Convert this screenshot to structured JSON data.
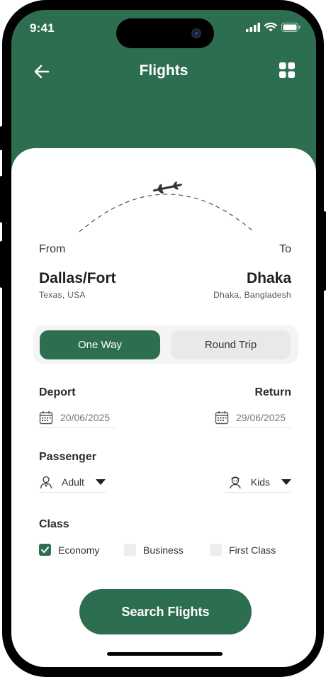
{
  "status": {
    "time": "9:41"
  },
  "header": {
    "title": "Flights"
  },
  "route": {
    "from_label": "From",
    "to_label": "To",
    "from_city": "Dallas/Fort",
    "from_region": "Texas, USA",
    "to_city": "Dhaka",
    "to_region": "Dhaka, Bangladesh"
  },
  "trip_type": {
    "one_way": "One Way",
    "round_trip": "Round Trip",
    "selected": "One Way"
  },
  "dates": {
    "depart_label": "Deport",
    "return_label": "Return",
    "depart_value": "20/06/2025",
    "return_value": "29/06/2025"
  },
  "passenger": {
    "label": "Passenger",
    "adult": "Adult",
    "kids": "Kids"
  },
  "class": {
    "label": "Class",
    "options": [
      {
        "label": "Economy",
        "checked": true
      },
      {
        "label": "Business",
        "checked": false
      },
      {
        "label": "First Class",
        "checked": false
      }
    ]
  },
  "actions": {
    "search": "Search Flights"
  },
  "colors": {
    "primary": "#2e6e50",
    "surface": "#ffffff"
  },
  "icons": [
    "back-arrow-icon",
    "grid-menu-icon",
    "airplane-icon",
    "calendar-icon",
    "adult-person-icon",
    "kid-person-icon",
    "signal-icon",
    "wifi-icon",
    "battery-icon"
  ]
}
